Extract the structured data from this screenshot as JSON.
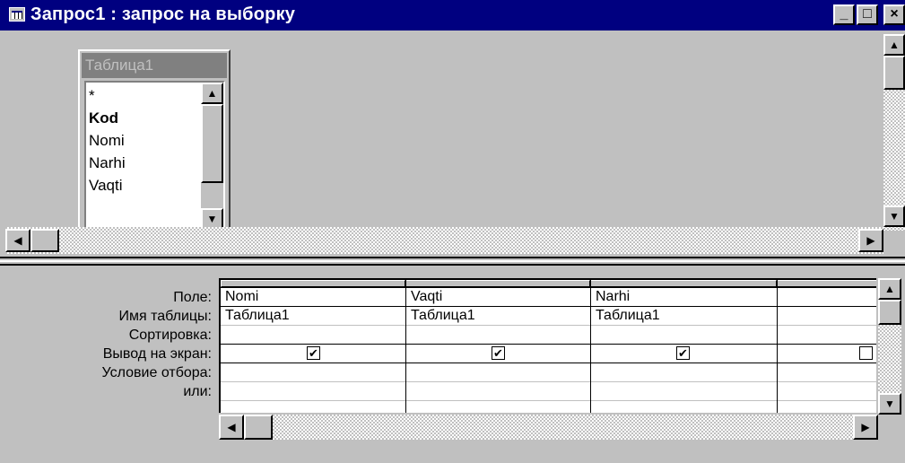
{
  "window": {
    "title": "Запрос1 : запрос на выборку",
    "controls": {
      "minimize": "_",
      "maximize": "□",
      "close": "×"
    }
  },
  "table": {
    "title": "Таблица1",
    "fields": [
      "*",
      "Kod",
      "Nomi",
      "Narhi",
      "Vaqti"
    ],
    "primary_key": "Kod"
  },
  "grid": {
    "row_labels": [
      "Поле:",
      "Имя таблицы:",
      "Сортировка:",
      "Вывод на экран:",
      "Условие отбора:",
      "или:"
    ],
    "columns": [
      {
        "field": "Nomi",
        "table": "Таблица1",
        "sort": "",
        "show": true,
        "criteria": "",
        "or": ""
      },
      {
        "field": "Vaqti",
        "table": "Таблица1",
        "sort": "",
        "show": true,
        "criteria": "",
        "or": ""
      },
      {
        "field": "Narhi",
        "table": "Таблица1",
        "sort": "",
        "show": true,
        "criteria": "",
        "or": ""
      },
      {
        "field": "",
        "table": "",
        "sort": "",
        "show": false,
        "criteria": "",
        "or": ""
      }
    ]
  },
  "glyphs": {
    "up": "▲",
    "down": "▼",
    "left": "◀",
    "right": "▶",
    "check": "✔"
  }
}
